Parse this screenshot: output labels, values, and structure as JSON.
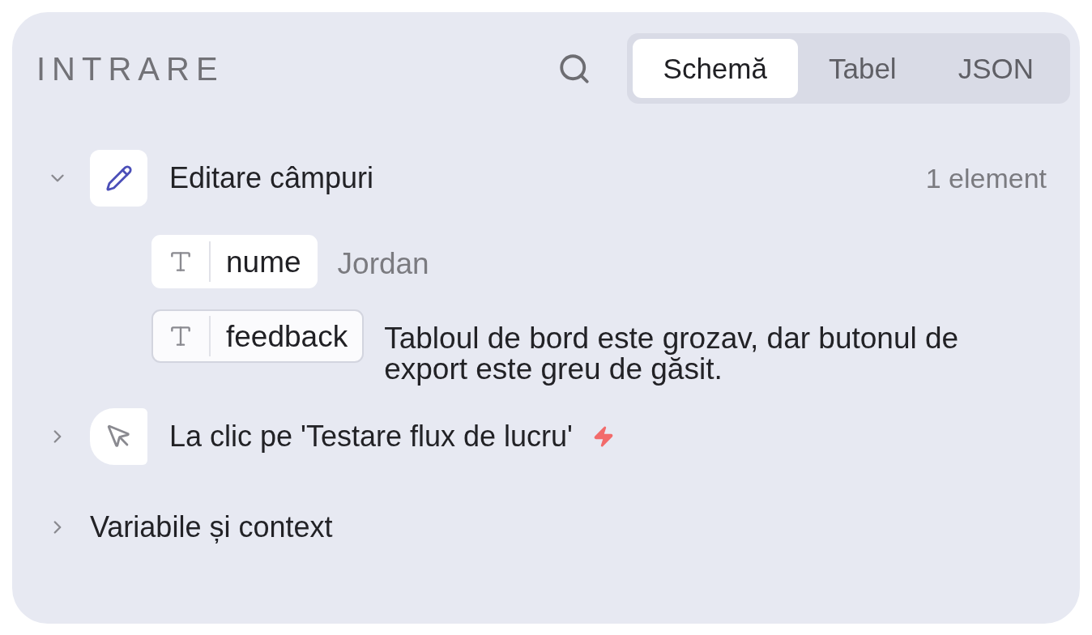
{
  "panel": {
    "title": "INTRARE"
  },
  "tabs": [
    {
      "label": "Schemă",
      "selected": true
    },
    {
      "label": "Tabel",
      "selected": false
    },
    {
      "label": "JSON",
      "selected": false
    }
  ],
  "sections": [
    {
      "kind": "edit",
      "title": "Editare câmpuri",
      "expanded": true,
      "count": "1 element",
      "fields": [
        {
          "name": "nume",
          "value": "Jordan",
          "selected": false
        },
        {
          "name": "feedback",
          "value": "Tabloul de bord este grozav, dar butonul de export este greu de găsit.",
          "selected": true
        }
      ]
    },
    {
      "kind": "trigger",
      "title": "La clic pe 'Testare flux de lucru'",
      "expanded": false
    },
    {
      "kind": "group",
      "title": "Variabile și context",
      "expanded": false
    }
  ]
}
